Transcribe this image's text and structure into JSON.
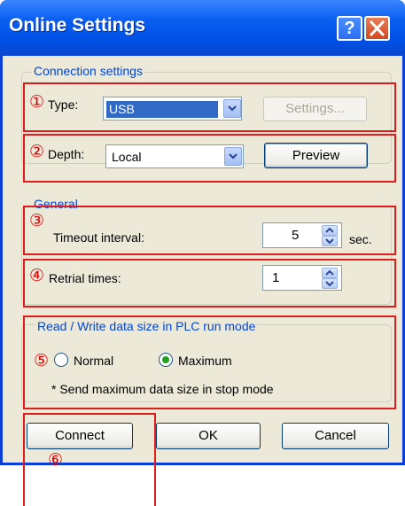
{
  "window": {
    "title": "Online Settings"
  },
  "titlebar": {
    "help_label": "?"
  },
  "connection": {
    "legend": "Connection settings",
    "type": {
      "marker": "①",
      "label": "Type:",
      "value": "USB",
      "settings_button": "Settings..."
    },
    "depth": {
      "marker": "②",
      "label": "Depth:",
      "value": "Local",
      "preview_button": "Preview"
    }
  },
  "general": {
    "legend": "General",
    "timeout": {
      "marker": "③",
      "label": "Timeout interval:",
      "value": "5",
      "unit": "sec."
    },
    "retrial": {
      "marker": "④",
      "label": "Retrial times:",
      "value": "1"
    }
  },
  "rw_size": {
    "legend": "Read / Write data size in PLC run mode",
    "marker": "⑤",
    "options": [
      {
        "label": "Normal",
        "selected": false
      },
      {
        "label": "Maximum",
        "selected": true
      }
    ],
    "note": "* Send maximum data size in stop mode"
  },
  "buttons": {
    "connect": "Connect",
    "ok": "OK",
    "cancel": "Cancel",
    "marker": "⑥"
  },
  "colors": {
    "annotation": "#e01b1b",
    "titlebar": "#0052e6",
    "legend_text": "#0046d5"
  }
}
